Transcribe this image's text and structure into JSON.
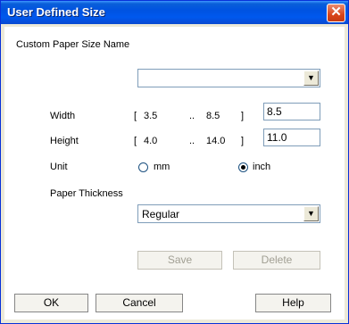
{
  "window": {
    "title": "User Defined Size",
    "close_glyph": "✕"
  },
  "custom_name": {
    "label": "Custom Paper Size Name",
    "value": ""
  },
  "width": {
    "label": "Width",
    "range_open": "[",
    "min": "3.5",
    "dots": "..",
    "max": "8.5",
    "range_close": "]",
    "value": "8.5"
  },
  "height": {
    "label": "Height",
    "range_open": "[",
    "min": "4.0",
    "dots": "..",
    "max": "14.0",
    "range_close": "]",
    "value": "11.0"
  },
  "unit": {
    "label": "Unit",
    "mm_label": "mm",
    "inch_label": "inch",
    "selected": "inch"
  },
  "thickness": {
    "label": "Paper Thickness",
    "value": "Regular"
  },
  "buttons": {
    "save": "Save",
    "delete": "Delete",
    "ok": "OK",
    "cancel": "Cancel",
    "help": "Help"
  },
  "icons": {
    "dropdown": "▼"
  },
  "colors": {
    "titlebar": "#0053e1",
    "close": "#d9451b"
  }
}
